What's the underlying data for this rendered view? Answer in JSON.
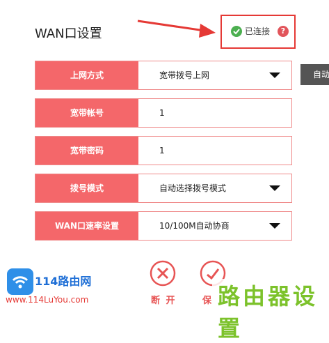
{
  "header": {
    "title": "WAN口设置",
    "status_text": "已连接",
    "help_label": "?"
  },
  "side_button_label": "自动",
  "form": {
    "rows": [
      {
        "label": "上网方式",
        "value": "宽带拨号上网",
        "type": "select"
      },
      {
        "label": "宽带帐号",
        "value": "1",
        "type": "input"
      },
      {
        "label": "宽带密码",
        "value": "1",
        "type": "input"
      },
      {
        "label": "拨号模式",
        "value": "自动选择拨号模式",
        "type": "select"
      },
      {
        "label": "WAN口速率设置",
        "value": "10/100M自动协商",
        "type": "select"
      }
    ]
  },
  "actions": {
    "disconnect_label": "断 开",
    "save_label": "保"
  },
  "watermark": {
    "left_brand": "114路由网",
    "left_url": "www.114LuYou.com",
    "right_brand": "路由器设置"
  },
  "colors": {
    "accent": "#f4676a",
    "highlight_border": "#e53935",
    "ok_green": "#4caf50"
  }
}
